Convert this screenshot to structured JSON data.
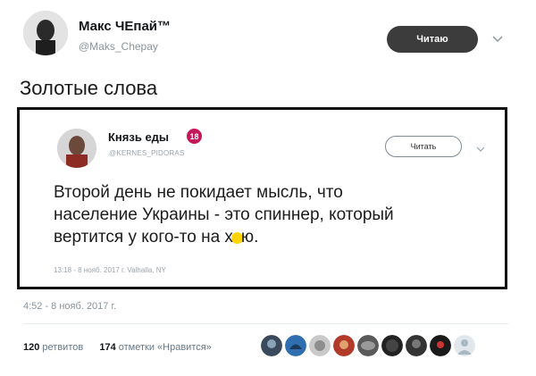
{
  "tweet": {
    "display_name": "Макс ЧЕпай™",
    "handle": "@Maks_Chepay",
    "follow_label": "Читаю",
    "text": "Золотые слова",
    "timestamp": "4:52 - 8 нояб. 2017 г.",
    "retweets_count": "120",
    "retweets_label": "ретвитов",
    "likes_count": "174",
    "likes_label": "отметки «Нравится»"
  },
  "quoted": {
    "display_name": "Князь еды",
    "badge": "18",
    "handle": "@KERNES_PIDORAS",
    "follow_label": "Читать",
    "lines": [
      "Второй день не покидает мысль, что",
      "население Украины - это спиннер, который",
      "вертится у кого-то на х",
      "ю."
    ],
    "meta": "13:18 - 8 нояб. 2017 г. Valhalla, NY"
  },
  "icons": {
    "avatar": "user-avatar",
    "quoted_avatar": "quoted-user-avatar",
    "chevron": "chevron-down-icon",
    "censor": "yellow-censor-blob"
  },
  "colors": {
    "follow_button": "#3c3c3c",
    "badge": "#c2185b",
    "censor": "#ffd400"
  }
}
